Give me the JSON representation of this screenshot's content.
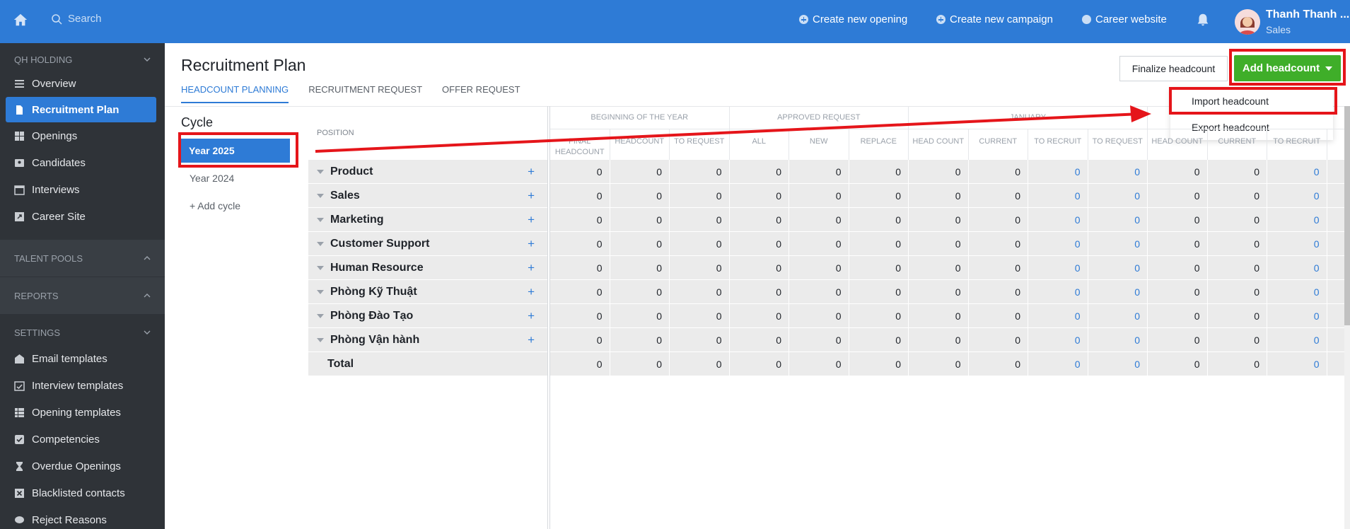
{
  "topbar": {
    "search_placeholder": "Search",
    "create_opening": "Create new opening",
    "create_campaign": "Create new campaign",
    "career_website": "Career website",
    "user_name": "Thanh Thanh ...",
    "user_role": "Sales"
  },
  "sidebar": {
    "org": "QH HOLDING",
    "items": [
      "Overview",
      "Recruitment Plan",
      "Openings",
      "Candidates",
      "Interviews",
      "Career Site"
    ],
    "talent_pools": "TALENT POOLS",
    "reports": "REPORTS",
    "settings": "SETTINGS",
    "settings_items": [
      "Email templates",
      "Interview templates",
      "Opening templates",
      "Competencies",
      "Overdue Openings",
      "Blacklisted contacts",
      "Reject Reasons"
    ]
  },
  "page": {
    "title": "Recruitment Plan",
    "tabs": [
      "HEADCOUNT PLANNING",
      "RECRUITMENT REQUEST",
      "OFFER REQUEST"
    ],
    "finalize_button": "Finalize headcount",
    "add_button": "Add headcount",
    "dropdown": [
      "Import headcount",
      "Export headcount"
    ]
  },
  "cycle": {
    "title": "Cycle",
    "items": [
      "Year 2025",
      "Year 2024"
    ],
    "add": "+ Add cycle"
  },
  "table": {
    "position_header": "POSITION",
    "groups": [
      "BEGINNING OF THE YEAR",
      "APPROVED REQUEST",
      "JANUARY"
    ],
    "sub_headers": [
      "FINAL HEADCOUNT",
      "HEADCOUNT",
      "TO REQUEST",
      "ALL",
      "NEW",
      "REPLACE",
      "HEAD COUNT",
      "CURRENT",
      "TO RECRUIT",
      "TO REQUEST",
      "HEAD COUNT",
      "CURRENT",
      "TO RECRUIT",
      "TO"
    ],
    "rows": [
      {
        "name": "Product",
        "values": [
          "0",
          "0",
          "0",
          "0",
          "0",
          "0",
          "0",
          "0",
          "0",
          "0",
          "0",
          "0",
          "0"
        ]
      },
      {
        "name": "Sales",
        "values": [
          "0",
          "0",
          "0",
          "0",
          "0",
          "0",
          "0",
          "0",
          "0",
          "0",
          "0",
          "0",
          "0"
        ]
      },
      {
        "name": "Marketing",
        "values": [
          "0",
          "0",
          "0",
          "0",
          "0",
          "0",
          "0",
          "0",
          "0",
          "0",
          "0",
          "0",
          "0"
        ]
      },
      {
        "name": "Customer Support",
        "values": [
          "0",
          "0",
          "0",
          "0",
          "0",
          "0",
          "0",
          "0",
          "0",
          "0",
          "0",
          "0",
          "0"
        ]
      },
      {
        "name": "Human Resource",
        "values": [
          "0",
          "0",
          "0",
          "0",
          "0",
          "0",
          "0",
          "0",
          "0",
          "0",
          "0",
          "0",
          "0"
        ]
      },
      {
        "name": "Phòng Kỹ Thuật",
        "values": [
          "0",
          "0",
          "0",
          "0",
          "0",
          "0",
          "0",
          "0",
          "0",
          "0",
          "0",
          "0",
          "0"
        ]
      },
      {
        "name": "Phòng Đào Tạo",
        "values": [
          "0",
          "0",
          "0",
          "0",
          "0",
          "0",
          "0",
          "0",
          "0",
          "0",
          "0",
          "0",
          "0"
        ]
      },
      {
        "name": "Phòng Vận hành",
        "values": [
          "0",
          "0",
          "0",
          "0",
          "0",
          "0",
          "0",
          "0",
          "0",
          "0",
          "0",
          "0",
          "0"
        ]
      }
    ],
    "total": {
      "name": "Total",
      "values": [
        "0",
        "0",
        "0",
        "0",
        "0",
        "0",
        "0",
        "0",
        "0",
        "0",
        "0",
        "0",
        "0"
      ]
    }
  },
  "colors": {
    "primary": "#2e7bd6",
    "success": "#3fae29",
    "highlight": "#e5151a",
    "sidebar": "#2f3338"
  }
}
